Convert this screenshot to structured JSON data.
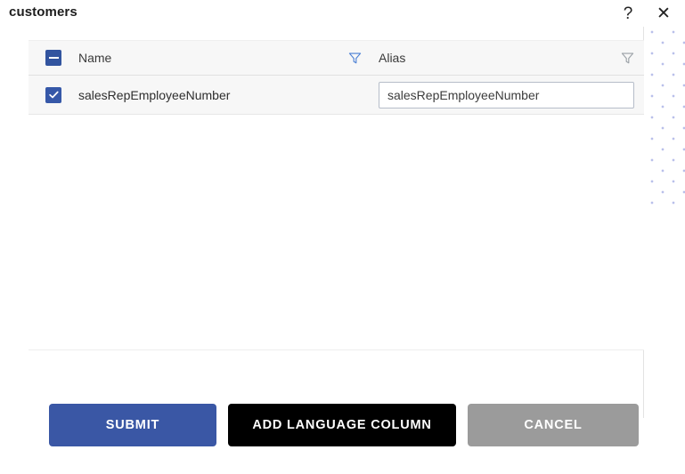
{
  "dialog": {
    "title": "customers",
    "help_icon": "question-mark-icon",
    "close_icon": "close-x-icon",
    "help_glyph": "?",
    "close_glyph": "✕"
  },
  "grid": {
    "select_all_state": "indeterminate",
    "columns": [
      {
        "key": "name",
        "label": "Name",
        "filter_icon": "filter-funnel-icon",
        "filter_active": true
      },
      {
        "key": "alias",
        "label": "Alias",
        "filter_icon": "filter-funnel-icon",
        "filter_active": false
      }
    ],
    "rows": [
      {
        "checked": true,
        "name": "salesRepEmployeeNumber",
        "alias_value": "salesRepEmployeeNumber",
        "alias_placeholder": "Alias"
      }
    ]
  },
  "actions": {
    "submit_label": "SUBMIT",
    "add_language_label": "ADD LANGUAGE COLUMN",
    "cancel_label": "CANCEL"
  },
  "colors": {
    "accent_blue": "#3a57a5",
    "checkbox_blue": "#3658a8",
    "filter_active_blue": "#4a7fd4",
    "filter_inactive_gray": "#9aa0a6",
    "black_button": "#000000",
    "cancel_gray": "#9b9b9b",
    "dot_pattern": "#b9c0ea",
    "header_row_bg": "#f7f7f7"
  }
}
